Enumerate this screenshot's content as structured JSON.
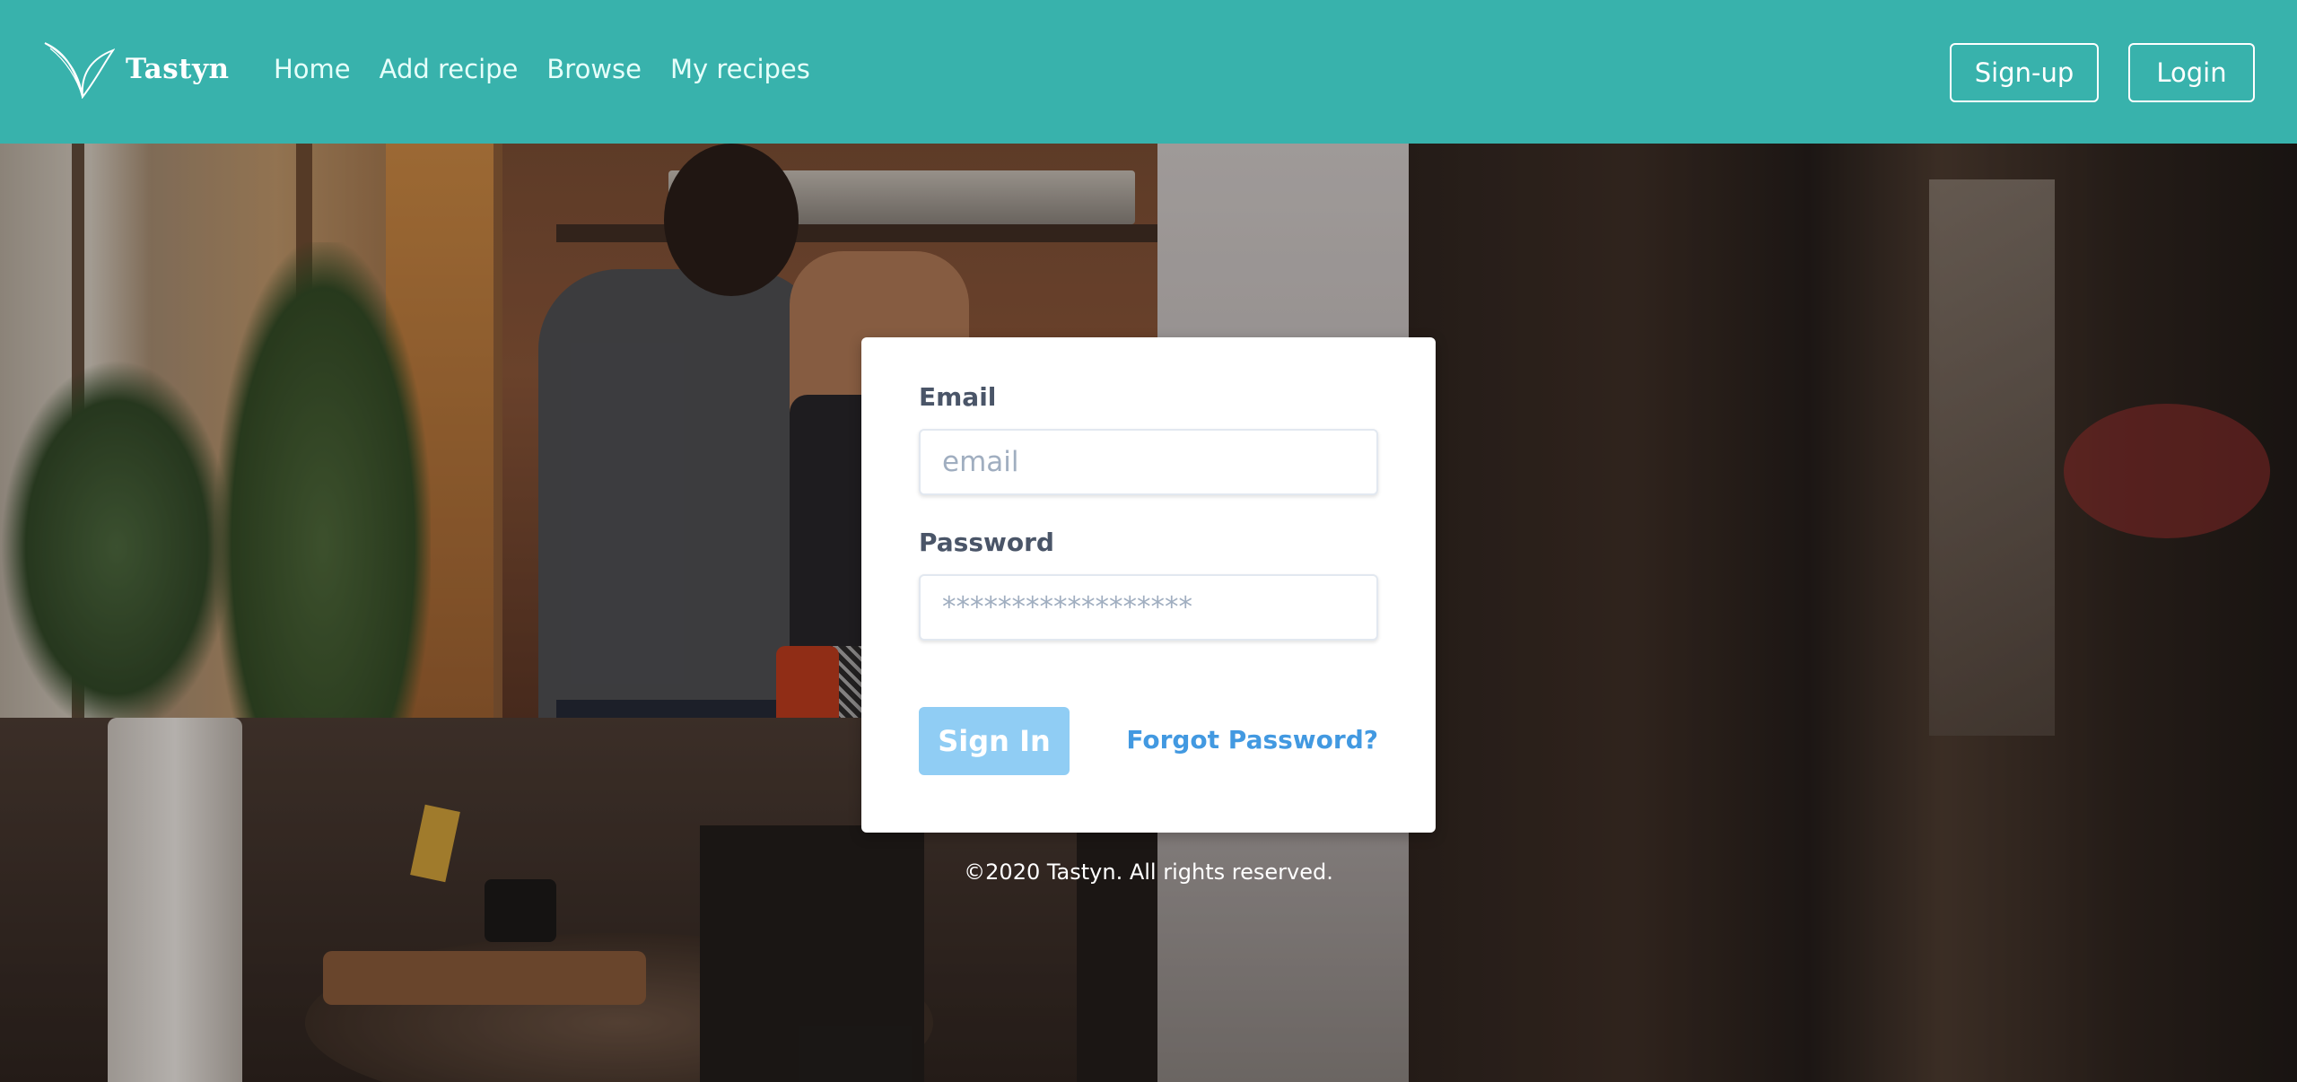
{
  "app": {
    "brand": "Tastyn",
    "accent_color": "#38b2ac",
    "logo_icon": "leaf-sprout-icon"
  },
  "nav": {
    "items": [
      {
        "label": "Home"
      },
      {
        "label": "Add recipe"
      },
      {
        "label": "Browse"
      },
      {
        "label": "My recipes"
      }
    ]
  },
  "header_actions": {
    "signup_label": "Sign-up",
    "login_label": "Login"
  },
  "login_form": {
    "email_label": "Email",
    "email_placeholder": "email",
    "email_value": "",
    "password_label": "Password",
    "password_placeholder": "******************",
    "password_value": "",
    "submit_label": "Sign In",
    "submit_color": "#90cdf4",
    "forgot_label": "Forgot Password?",
    "link_color": "#4299e1"
  },
  "footer": {
    "copyright": "©2020 Tastyn. All rights reserved."
  }
}
